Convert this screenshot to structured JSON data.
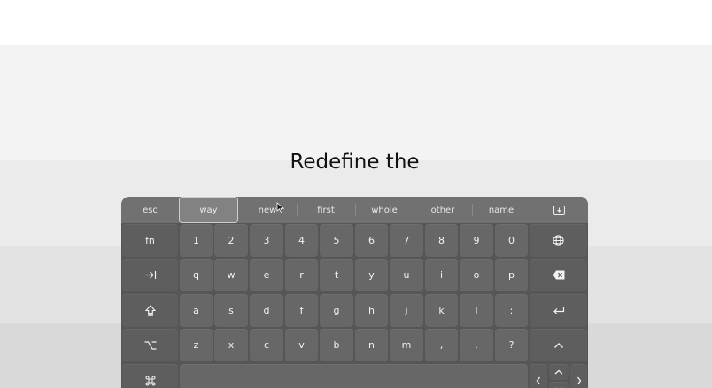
{
  "editor": {
    "typed_text": "Redefine the"
  },
  "suggestions": {
    "esc_label": "esc",
    "words": [
      "way",
      "new",
      "first",
      "whole",
      "other",
      "name"
    ],
    "selected_index": 0,
    "hide_keyboard_icon": "keyboard-hide-icon"
  },
  "keyboard": {
    "row1": [
      "fn",
      "1",
      "2",
      "3",
      "4",
      "5",
      "6",
      "7",
      "8",
      "9",
      "0"
    ],
    "row1_globe_icon": "globe-icon",
    "row2_tab_icon": "tab-icon",
    "row2": [
      "q",
      "w",
      "e",
      "r",
      "t",
      "y",
      "u",
      "i",
      "o",
      "p"
    ],
    "row2_backspace_icon": "backspace-icon",
    "row3_shift_icon": "shift-icon",
    "row3": [
      "a",
      "s",
      "d",
      "f",
      "g",
      "h",
      "j",
      "k",
      "l",
      ":"
    ],
    "row3_return_icon": "return-icon",
    "row4_option_icon": "option-icon",
    "row4": [
      "z",
      "x",
      "c",
      "v",
      "b",
      "n",
      "m",
      ",",
      ".",
      "?"
    ],
    "row4_up_icon": "chevron-up-icon",
    "row5_command_icon": "command-icon",
    "row5_space_label": "",
    "row5_arrows": [
      "chevron-left-icon",
      "chevron-up-icon",
      "chevron-down-icon",
      "chevron-right-icon"
    ]
  },
  "colors": {
    "keyboard_bg": "#565656",
    "key_bg": "#676767",
    "suggestion_bar_bg": "#717171",
    "key_text": "#f2f2f2"
  }
}
